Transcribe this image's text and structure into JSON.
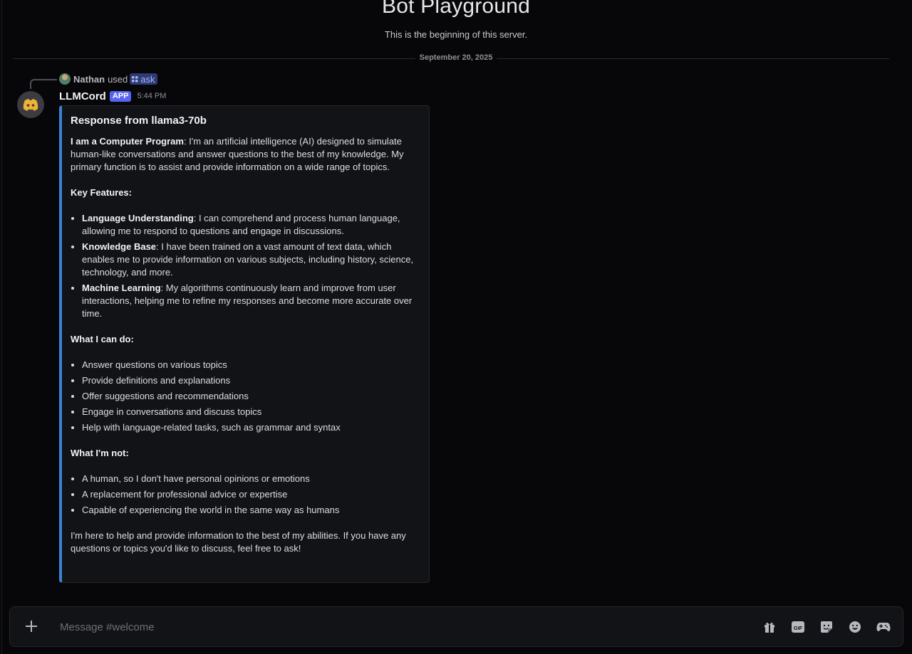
{
  "server": {
    "title": "Bot Playground",
    "subtitle": "This is the beginning of this server.",
    "date_divider": "September 20, 2025"
  },
  "reply": {
    "user": "Nathan",
    "used_text": "used",
    "command": "ask"
  },
  "message": {
    "author": "LLMCord",
    "badge": "APP",
    "timestamp": "5:44 PM"
  },
  "embed": {
    "title": "Response from llama3-70b",
    "accent_color": "#3b82d6",
    "intro_bold": "I am a Computer Program",
    "intro_text": ": I'm an artificial intelligence (AI) designed to simulate human-like conversations and answer questions to the best of my knowledge. My primary function is to assist and provide information on a wide range of topics.",
    "key_features_heading": "Key Features:",
    "key_features": [
      {
        "bold": "Language Understanding",
        "text": ": I can comprehend and process human language, allowing me to respond to questions and engage in discussions."
      },
      {
        "bold": "Knowledge Base",
        "text": ": I have been trained on a vast amount of text data, which enables me to provide information on various subjects, including history, science, technology, and more."
      },
      {
        "bold": "Machine Learning",
        "text": ": My algorithms continuously learn and improve from user interactions, helping me to refine my responses and become more accurate over time."
      }
    ],
    "can_do_heading": "What I can do:",
    "can_do": [
      "Answer questions on various topics",
      "Provide definitions and explanations",
      "Offer suggestions and recommendations",
      "Engage in conversations and discuss topics",
      "Help with language-related tasks, such as grammar and syntax"
    ],
    "not_heading": "What I'm not:",
    "not_list": [
      "A human, so I don't have personal opinions or emotions",
      "A replacement for professional advice or expertise",
      "Capable of experiencing the world in the same way as humans"
    ],
    "closing": "I'm here to help and provide information to the best of my abilities. If you have any questions or topics you'd like to discuss, feel free to ask!"
  },
  "composer": {
    "placeholder": "Message #welcome",
    "value": "",
    "icons": [
      "plus-icon",
      "gift-icon",
      "gif-icon",
      "sticker-icon",
      "emoji-icon",
      "apps-icon"
    ]
  },
  "colors": {
    "background": "#070709",
    "brand": "#5865f2",
    "command_chip": "#2e3a70"
  }
}
